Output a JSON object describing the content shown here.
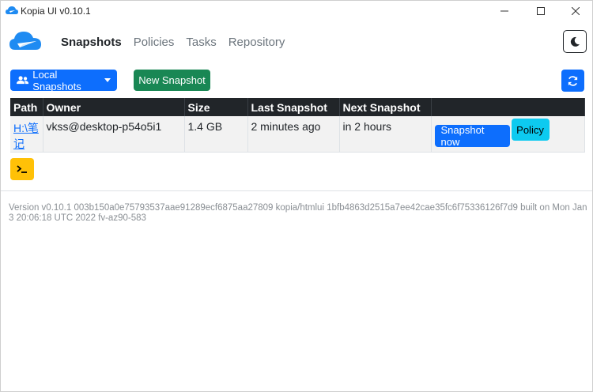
{
  "window": {
    "title": "Kopia UI v0.10.1"
  },
  "nav": {
    "items": [
      {
        "label": "Snapshots",
        "active": true
      },
      {
        "label": "Policies",
        "active": false
      },
      {
        "label": "Tasks",
        "active": false
      },
      {
        "label": "Repository",
        "active": false
      }
    ],
    "theme_icon": "moon-icon"
  },
  "toolbar": {
    "local_snapshots_label": "Local Snapshots",
    "new_snapshot_label": "New Snapshot",
    "refresh_icon": "refresh-icon"
  },
  "table": {
    "headers": [
      "Path",
      "Owner",
      "Size",
      "Last Snapshot",
      "Next Snapshot",
      ""
    ],
    "rows": [
      {
        "path": "H:\\笔记",
        "owner": "vkss@desktop-p54o5i1",
        "size": "1.4 GB",
        "last_snapshot": "2 minutes ago",
        "next_snapshot": "in 2 hours",
        "snapshot_now_label": "Snapshot now",
        "policy_label": "Policy"
      }
    ]
  },
  "terminal_icon": "terminal-icon",
  "footer": {
    "version_text": "Version v0.10.1 003b150a0e75793537aae91289ecf6875aa27809 kopia/htmlui 1bfb4863d2515a7ee42cae35fc6f75336126f7d9 built on Mon Jan 3 20:06:18 UTC 2022 fv-az90-583"
  },
  "colors": {
    "primary": "#0d6efd",
    "success": "#198754",
    "info": "#0dcaf0",
    "warning": "#ffc107",
    "table_header": "#212529"
  }
}
